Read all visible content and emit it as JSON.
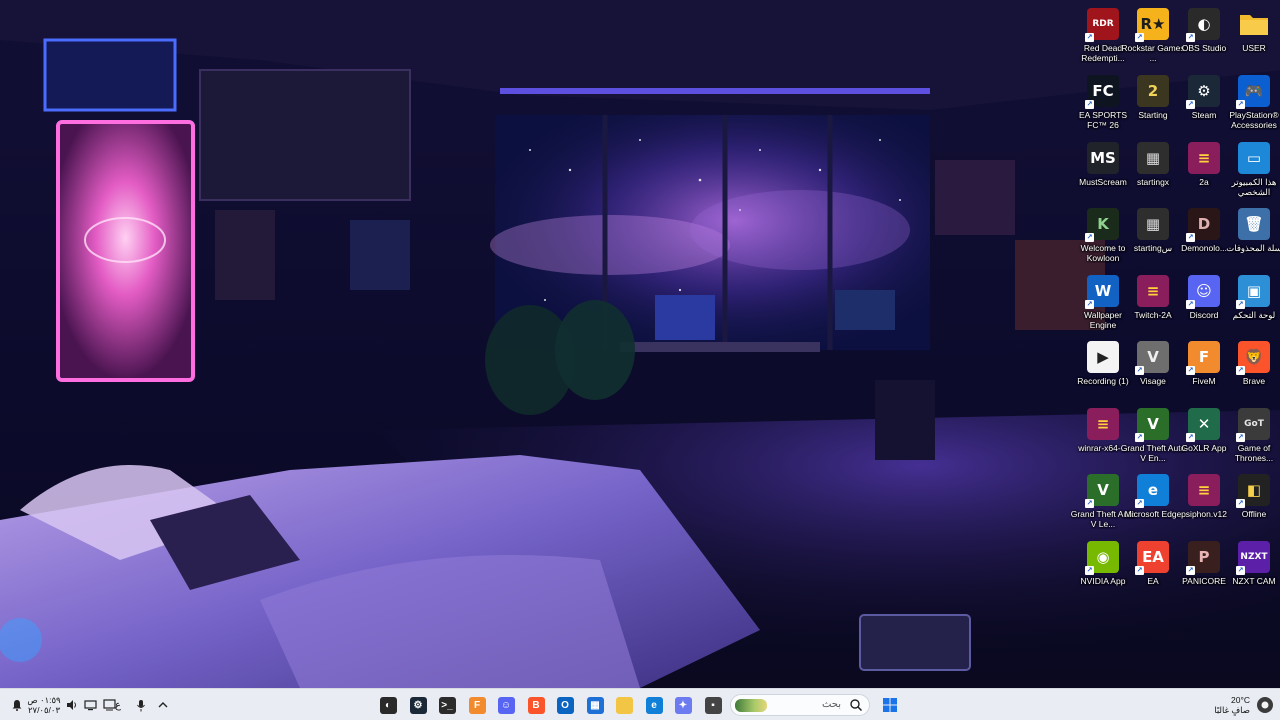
{
  "desktop": {
    "icons": [
      {
        "name": "red-dead-redemption",
        "label": "Red Dead Redempti...",
        "glyph": "RDR",
        "bg": "#a0141b",
        "color": "#ffffff",
        "shortcut": true
      },
      {
        "name": "rockstar-games",
        "label": "Rockstar Games ...",
        "glyph": "R★",
        "bg": "#f6b21b",
        "color": "#1c1c1c",
        "shortcut": true
      },
      {
        "name": "obs-studio",
        "label": "OBS Studio",
        "glyph": "◐",
        "bg": "#2a2a2a",
        "color": "#ffffff",
        "shortcut": true
      },
      {
        "name": "user-folder",
        "label": "USER",
        "glyph": "",
        "bg": "folder",
        "color": "#ffffff",
        "shortcut": false
      },
      {
        "name": "ea-sports-fc",
        "label": "EA SPORTS FC™ 26",
        "glyph": "FC",
        "bg": "#0e1420",
        "color": "#ffffff",
        "shortcut": true
      },
      {
        "name": "starting-exe",
        "label": "Starting",
        "glyph": "2",
        "bg": "#3b3620",
        "color": "#f2d35a",
        "shortcut": false
      },
      {
        "name": "steam",
        "label": "Steam",
        "glyph": "⚙",
        "bg": "#1b2838",
        "color": "#ffffff",
        "shortcut": true
      },
      {
        "name": "playstation-accessories",
        "label": "PlayStation® Accessories",
        "glyph": "🎮",
        "bg": "#0b5fd0",
        "color": "#ffffff",
        "shortcut": true
      },
      {
        "name": "mustscream",
        "label": "MustScream",
        "glyph": "MS",
        "bg": "#20232a",
        "color": "#ffffff",
        "shortcut": false
      },
      {
        "name": "startingx",
        "label": "startingx",
        "glyph": "▦",
        "bg": "#2e2e2e",
        "color": "#d7d7d7",
        "shortcut": false
      },
      {
        "name": "archive-2a",
        "label": "2a",
        "glyph": "≡",
        "bg": "#8a1d5c",
        "color": "#ffd33a",
        "shortcut": false
      },
      {
        "name": "this-pc",
        "label": "هذا الكمبيوتر الشخصي",
        "glyph": "▭",
        "bg": "#1e88d8",
        "color": "#ffffff",
        "shortcut": false
      },
      {
        "name": "welcome-to-kowloon",
        "label": "Welcome to Kowloon",
        "glyph": "K",
        "bg": "#1b2b1b",
        "color": "#8fd18f",
        "shortcut": true
      },
      {
        "name": "starting-s",
        "label": "startingس",
        "glyph": "▦",
        "bg": "#2e2e2e",
        "color": "#d7d7d7",
        "shortcut": false
      },
      {
        "name": "demonologist",
        "label": "Demonolo...",
        "glyph": "D",
        "bg": "#2a1616",
        "color": "#e0b0b0",
        "shortcut": true
      },
      {
        "name": "recycle-bin",
        "label": "سلة المحذوفات",
        "glyph": "🗑",
        "bg": "#3d6fa8",
        "color": "#ffffff",
        "shortcut": false
      },
      {
        "name": "wallpaper-engine",
        "label": "Wallpaper Engine",
        "glyph": "W",
        "bg": "#1262c4",
        "color": "#ffffff",
        "shortcut": true
      },
      {
        "name": "twitch-2a",
        "label": "Twitch-2A",
        "glyph": "≡",
        "bg": "#8a1d5c",
        "color": "#ffd33a",
        "shortcut": false
      },
      {
        "name": "discord",
        "label": "Discord",
        "glyph": "☺",
        "bg": "#5865f2",
        "color": "#ffffff",
        "shortcut": true
      },
      {
        "name": "control-panel",
        "label": "لوحة التحكم",
        "glyph": "▣",
        "bg": "#2d8fd6",
        "color": "#ffffff",
        "shortcut": true
      },
      {
        "name": "recording-1",
        "label": "Recording (1)",
        "glyph": "▶",
        "bg": "#f4f4f4",
        "color": "#222222",
        "shortcut": false
      },
      {
        "name": "visage",
        "label": "Visage",
        "glyph": "V",
        "bg": "#6e6e6e",
        "color": "#f0f0f0",
        "shortcut": true
      },
      {
        "name": "fivem",
        "label": "FiveM",
        "glyph": "F",
        "bg": "#f28a2e",
        "color": "#ffffff",
        "shortcut": true
      },
      {
        "name": "brave",
        "label": "Brave",
        "glyph": "🦁",
        "bg": "#fb542b",
        "color": "#ffffff",
        "shortcut": true
      },
      {
        "name": "winrar",
        "label": "winrar-x64-...",
        "glyph": "≡",
        "bg": "#8a1d5c",
        "color": "#ffd33a",
        "shortcut": false
      },
      {
        "name": "gta-v-enhanced",
        "label": "Grand Theft Auto V En...",
        "glyph": "V",
        "bg": "#2a6e2a",
        "color": "#ffffff",
        "shortcut": true
      },
      {
        "name": "goxlr-app",
        "label": "GoXLR App",
        "glyph": "✕",
        "bg": "#1f6b4a",
        "color": "#ffffff",
        "shortcut": true
      },
      {
        "name": "game-of-thrones",
        "label": "Game of Thrones...",
        "glyph": "GoT",
        "bg": "#3b3b3b",
        "color": "#e6e6e6",
        "shortcut": true
      },
      {
        "name": "gta-v-legacy",
        "label": "Grand Theft Auto V Le...",
        "glyph": "V",
        "bg": "#2a6e2a",
        "color": "#ffffff",
        "shortcut": true
      },
      {
        "name": "microsoft-edge",
        "label": "Microsoft Edge",
        "glyph": "e",
        "bg": "#0f7fd8",
        "color": "#ffffff",
        "shortcut": true
      },
      {
        "name": "psiphon",
        "label": "psiphon.v12",
        "glyph": "≡",
        "bg": "#8a1d5c",
        "color": "#ffd33a",
        "shortcut": false
      },
      {
        "name": "offline",
        "label": "Offline",
        "glyph": "◧",
        "bg": "#222222",
        "color": "#f5d04a",
        "shortcut": true
      },
      {
        "name": "nvidia-app",
        "label": "NVIDIA App",
        "glyph": "◉",
        "bg": "#76b900",
        "color": "#ffffff",
        "shortcut": true
      },
      {
        "name": "ea-app",
        "label": "EA",
        "glyph": "EA",
        "bg": "#ef4130",
        "color": "#ffffff",
        "shortcut": true
      },
      {
        "name": "panicore",
        "label": "PANICORE",
        "glyph": "P",
        "bg": "#3a1f1f",
        "color": "#e9b4b4",
        "shortcut": true
      },
      {
        "name": "nzxt-cam",
        "label": "NZXT CAM",
        "glyph": "NZXT",
        "bg": "#5b1fa8",
        "color": "#ffffff",
        "shortcut": true
      }
    ]
  },
  "taskbar": {
    "search_placeholder": "بحث",
    "pinned": [
      {
        "name": "obs-taskbar",
        "glyph": "◐",
        "bg": "#2a2a2a"
      },
      {
        "name": "steam-taskbar",
        "glyph": "⚙",
        "bg": "#1b2838"
      },
      {
        "name": "terminal-taskbar",
        "glyph": ">_",
        "bg": "#2b2b2b"
      },
      {
        "name": "fivem-taskbar",
        "glyph": "F",
        "bg": "#f28a2e"
      },
      {
        "name": "discord-taskbar",
        "glyph": "☺",
        "bg": "#5865f2"
      },
      {
        "name": "brave-taskbar",
        "glyph": "B",
        "bg": "#fb542b"
      },
      {
        "name": "outlook-taskbar",
        "glyph": "O",
        "bg": "#0a64c2"
      },
      {
        "name": "store-taskbar",
        "glyph": "▦",
        "bg": "#1e6fd6"
      },
      {
        "name": "file-explorer-taskbar",
        "glyph": "",
        "bg": "#f3c544"
      },
      {
        "name": "edge-taskbar",
        "glyph": "e",
        "bg": "#0f7fd8"
      },
      {
        "name": "copilot-taskbar",
        "glyph": "✦",
        "bg": "#6d7bf0"
      },
      {
        "name": "app-taskbar",
        "glyph": "▪",
        "bg": "#444444"
      }
    ],
    "tray": {
      "time": "٠١:٥٩ ص",
      "date": "٢٧/٠٥/٠٣",
      "language": "ع",
      "weather_temp": "20°C",
      "weather_desc": "صافٍ غالبًا"
    }
  }
}
